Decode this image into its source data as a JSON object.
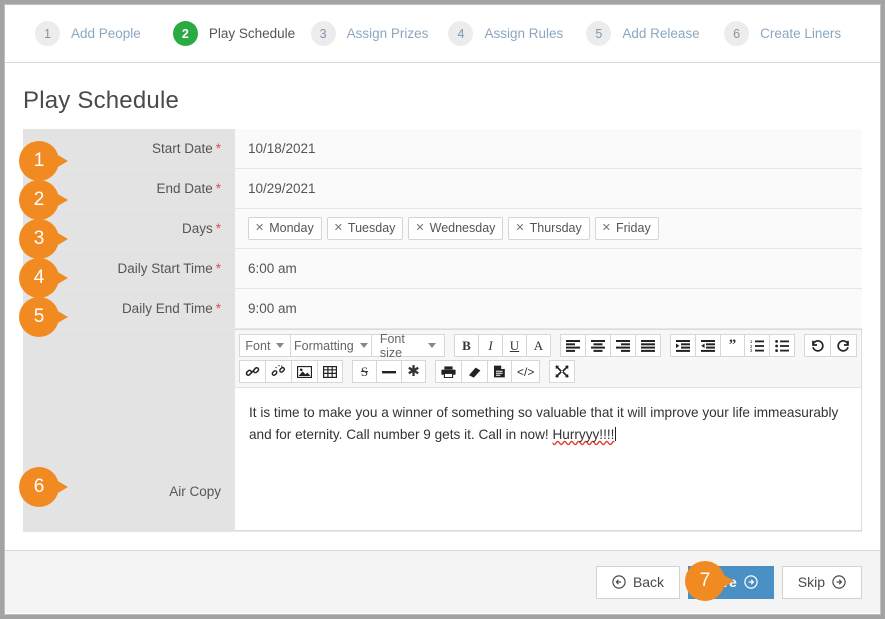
{
  "stepper": {
    "steps": [
      {
        "num": "1",
        "label": "Add People",
        "active": false
      },
      {
        "num": "2",
        "label": "Play Schedule",
        "active": true
      },
      {
        "num": "3",
        "label": "Assign Prizes",
        "active": false
      },
      {
        "num": "4",
        "label": "Assign Rules",
        "active": false
      },
      {
        "num": "5",
        "label": "Add Release",
        "active": false
      },
      {
        "num": "6",
        "label": "Create Liners",
        "active": false
      }
    ]
  },
  "page": {
    "title": "Play Schedule"
  },
  "form": {
    "required_marker": "*",
    "rows": [
      {
        "label": "Start Date",
        "required": true,
        "value": "10/18/2021",
        "badge": "1"
      },
      {
        "label": "End Date",
        "required": true,
        "value": "10/29/2021",
        "badge": "2"
      },
      {
        "label": "Days",
        "required": true,
        "value": "",
        "badge": "3"
      },
      {
        "label": "Daily Start Time",
        "required": true,
        "value": "6:00 am",
        "badge": "4"
      },
      {
        "label": "Daily End Time",
        "required": true,
        "value": "9:00 am",
        "badge": "5"
      }
    ],
    "days": [
      {
        "label": "Monday",
        "remove_icon": "close-icon"
      },
      {
        "label": "Tuesday",
        "remove_icon": "close-icon"
      },
      {
        "label": "Wednesday",
        "remove_icon": "close-icon"
      },
      {
        "label": "Thursday",
        "remove_icon": "close-icon"
      },
      {
        "label": "Friday",
        "remove_icon": "close-icon"
      }
    ]
  },
  "editor": {
    "label": "Air Copy",
    "badge": "6",
    "toolbar_row1": {
      "font_label": "Font",
      "formatting_label": "Formatting",
      "fontsize_label": "Font size",
      "bold": "B",
      "italic": "I",
      "underline": "U",
      "textcolor": "A"
    },
    "content_text_part1": "It is time to make you a winner of something so valuable that it will improve your life immeasurably and for eternity. Call number 9 gets it. Call in now! ",
    "content_text_misspelled": "Hurryyy!!!!"
  },
  "footer": {
    "back_label": "Back",
    "save_label": "Save",
    "skip_label": "Skip",
    "save_badge": "7"
  },
  "colors": {
    "accent_orange": "#f18a21",
    "active_green": "#2aaa43",
    "primary_blue": "#4a90c4",
    "label_grey": "#e3e3e3",
    "required_red": "#d9534f"
  }
}
